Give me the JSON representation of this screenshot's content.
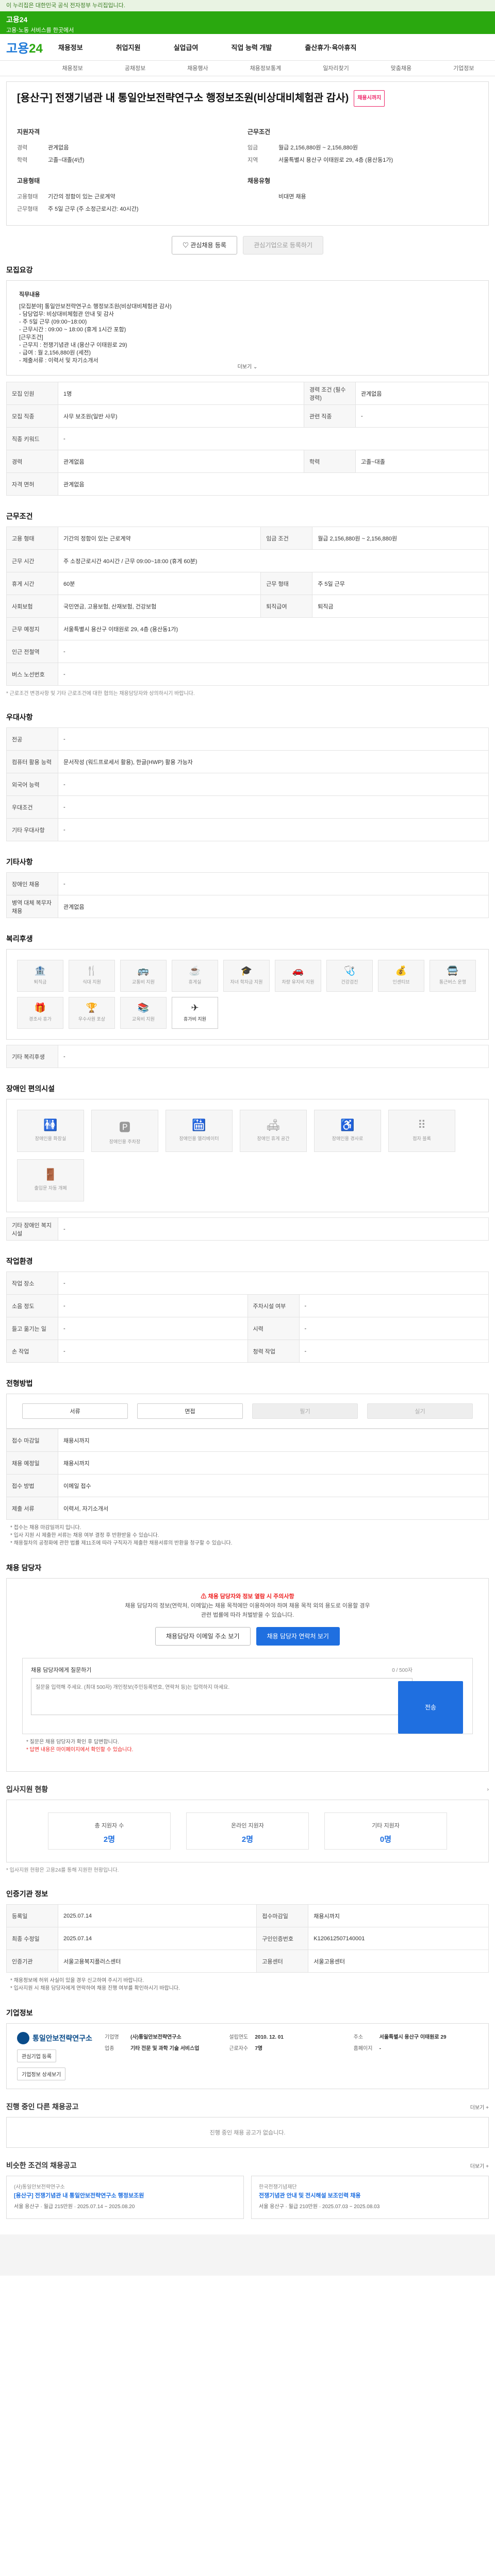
{
  "topbar": {
    "text": "이 누리집은 대한민국 공식 전자정부 누리집입니다."
  },
  "banner": {
    "title": "고용24",
    "subtitle": "고용·노동 서비스를 한곳에서"
  },
  "nav": {
    "logo_a": "고용",
    "logo_b": "24",
    "items": [
      "채용정보",
      "취업지원",
      "실업급여",
      "직업 능력 개발",
      "출산휴가·육아휴직"
    ]
  },
  "subnav": [
    "채용정보",
    "공채정보",
    "채용행사",
    "채용정보통계",
    "일자리찾기",
    "맞춤채용",
    "기업정보"
  ],
  "job": {
    "title": "[용산구] 전쟁기념관 내 통일안보전략연구소 행정보조원(비상대비체험관 감사)",
    "tag": "채용시까지",
    "summary_left_title": "지원자격",
    "left": [
      {
        "k": "경력",
        "v": "관계없음"
      },
      {
        "k": "학력",
        "v": "고졸~대졸(4년)"
      }
    ],
    "emp_title": "고용형태",
    "emp": [
      {
        "k": "고용형태",
        "v": "기간의 정함이 있는 근로계약"
      },
      {
        "k": "근무형태",
        "v": "주 5일 근무 (주 소정근로시간: 40시간)"
      }
    ],
    "summary_right_title": "근무조건",
    "right": [
      {
        "k": "임금",
        "v": "월급 2,156,880원 ~ 2,156,880원"
      },
      {
        "k": "지역",
        "v": "서울특별시 용산구 이태원로 29, 4층 (용산동1가)"
      }
    ],
    "reg_title": "채용유형",
    "reg": [
      {
        "k": "",
        "v": "비대면 채용"
      }
    ],
    "btn_interest": "관심채용 등록",
    "btn_interest_company": "관심기업으로 등록하기"
  },
  "sections": {
    "recruit": "모집요강",
    "conditions": "근무조건",
    "prefer": "우대사항",
    "other": "기타사항",
    "welfare": "복리후생",
    "disabled": "장애인 편의시설",
    "workplace": "작업환경",
    "process": "전형방법",
    "contact": "채용 담당자",
    "applicants": "입사지원 현황",
    "info": "인증기관 정보",
    "company": "기업정보",
    "other_jobs": "진행 중인 다른 채용공고",
    "similar": "비슷한 조건의 채용공고"
  },
  "desc": {
    "heading": "직무내용",
    "lines": [
      "[모집분야] 통일안보전략연구소 행정보조원(비상대비체험관 감사)",
      "- 담당업무: 비상대비체험관 안내 및 감사",
      "- 주 5일 근무 (09:00~18:00)",
      "- 근무시간 : 09:00 ~ 18:00 (휴게 1시간 포함)",
      "[근무조건]",
      "- 근무지 : 전쟁기념관 내 (용산구 이태원로 29)",
      "- 급여 : 월 2,156,880원 (세전)",
      "- 제출서류 : 이력서 및 자기소개서"
    ],
    "more": "더보기"
  },
  "recruit_table": [
    [
      "모집 인원",
      "1명",
      "경력 조건 (필수 경력)",
      "관계없음"
    ],
    [
      "모집 직종",
      "사무 보조원(일반 사무)",
      "관련 직종",
      "-"
    ],
    [
      "직종 키워드",
      "-",
      "",
      ""
    ],
    [
      "경력",
      "관계없음",
      "학력",
      "고졸~대졸"
    ],
    [
      "자격 면허",
      "관계없음",
      "",
      ""
    ]
  ],
  "cond_table": [
    [
      "고용 형태",
      "기간의 정함이 있는 근로계약",
      "임금 조건",
      "월급 2,156,880원 ~ 2,156,880원"
    ],
    [
      "근무 시간",
      "주 소정근로시간 40시간 / 근무 09:00~18:00 (휴게 60분)",
      "",
      ""
    ],
    [
      "휴게 시간",
      "60분",
      "근무 형태",
      "주 5일 근무"
    ],
    [
      "사회보험",
      "국민연금, 고용보험, 산재보험, 건강보험",
      "퇴직급여",
      "퇴직금"
    ],
    [
      "근무 예정지",
      "서울특별시 용산구 이태원로 29, 4층 (용산동1가)",
      "",
      ""
    ],
    [
      "인근 전철역",
      "-",
      "",
      ""
    ],
    [
      "버스 노선번호",
      "-",
      "",
      ""
    ]
  ],
  "cond_note": "* 근로조건 변경사항 및 기타 근로조건에 대한 협의는 채용담당자와 상의하시기 바랍니다.",
  "prefer_table": [
    [
      "전공",
      "-"
    ],
    [
      "컴퓨터 활용 능력",
      "문서작성 (워드프로세서 활용), 한글(HWP) 활용 가능자"
    ],
    [
      "외국어 능력",
      "-"
    ],
    [
      "우대조건",
      "-"
    ],
    [
      "기타 우대사항",
      "-"
    ]
  ],
  "other_table": [
    [
      "장애인 채용",
      "-"
    ],
    [
      "병역 대체 복무자 채용",
      "관계없음"
    ]
  ],
  "welfare": {
    "items": [
      "퇴직금",
      "식대 지원",
      "교통비 지원",
      "휴게실",
      "자녀 학자금 지원",
      "차량 유지비 지원",
      "건강검진",
      "인센티브",
      "통근버스 운행",
      "경조사 휴가",
      "우수사원 포상",
      "교육비 지원",
      "휴가비 지원"
    ],
    "active_index": 12,
    "other_label": "기타 복리후생",
    "other_value": "-"
  },
  "facilities": {
    "items": [
      "장애인용 화장실",
      "장애인용 주차장",
      "장애인용 엘리베이터",
      "장애인 휴게 공간",
      "장애인용 경사로",
      "점자 블록",
      "출입문 자동 개폐"
    ],
    "other_label": "기타 장애인 복지시설",
    "other_value": "-"
  },
  "workplace_table": [
    [
      "작업 장소",
      "-",
      "",
      ""
    ],
    [
      "소음 정도",
      "-",
      "주차시설 여부",
      "-"
    ],
    [
      "들고 옮기는 일",
      "-",
      "시력",
      "-"
    ],
    [
      "손 작업",
      "-",
      "청력 작업",
      "-"
    ]
  ],
  "process": {
    "steps": [
      "서류",
      "면접",
      "필기",
      "실기"
    ],
    "active": [
      true,
      true,
      false,
      false
    ],
    "rows": [
      [
        "접수 마감일",
        "채용시까지"
      ],
      [
        "채용 예정일",
        "채용시까지"
      ],
      [
        "접수 방법",
        "이메일 접수"
      ],
      [
        "제출 서류",
        "이력서, 자기소개서"
      ]
    ],
    "notes": [
      "* 접수는 채용 마감일까지 입니다.",
      "* 입사 지원 시 제출한 서류는 채용 여부 결정 후 반환받을 수 있습니다.",
      "* 채용절차의 공정화에 관한 법률 제11조에 따라 구직자가 제출한 채용서류의 반환을 청구할 수 있습니다."
    ]
  },
  "apply": {
    "warn": "채용 담당자와 정보 열람 시 주의사항",
    "lines": [
      "채용 담당자의 정보(연락처, 이메일)는 채용 목적에만 이용하여야 하며 채용 목적 외의 용도로 이용할 경우",
      "관련 법률에 따라 처벌받을 수 있습니다."
    ],
    "btn_email": "채용담당자 이메일 주소 보기",
    "btn_phone": "채용 담당자 연락처 보기",
    "q_title": "채용 담당자에게 질문하기",
    "q_count": "0 / 500자",
    "q_placeholder": "질문을 입력해 주세요. (최대 500자) 개인정보(주민등록번호, 연락처 등)는 입력하지 마세요.",
    "q_send": "전송",
    "q_notes": [
      "* 질문은 채용 담당자가 확인 후 답변합니다.",
      "* 답변 내용은 마이페이지에서 확인할 수 있습니다."
    ]
  },
  "applicants": {
    "items": [
      {
        "label": "총 지원자 수",
        "value": "2명"
      },
      {
        "label": "온라인 지원자",
        "value": "2명"
      },
      {
        "label": "기타 지원자",
        "value": "0명"
      }
    ],
    "note": "* 입사지원 현황은 고용24를 통해 지원한 현황입니다."
  },
  "info_table": [
    [
      "등록일",
      "2025.07.14",
      "접수마감일",
      "채용시까지"
    ],
    [
      "최종 수정일",
      "2025.07.14",
      "구인인증번호",
      "K120612507140001"
    ],
    [
      "인증기관",
      "서울고용복지플러스센터",
      "고용센터",
      "서울고용센터"
    ]
  ],
  "info_notes": [
    "* 채용정보에 허위 사실이 있을 경우 신고하여 주시기 바랍니다.",
    "* 입사지원 시 채용 담당자에게 연락하여 채용 진행 여부를 확인하시기 바랍니다."
  ],
  "company": {
    "name": "통일안보전략연구소",
    "btn1": "관심기업 등록",
    "btn2": "기업정보 상세보기",
    "c1": [
      {
        "k": "기업명",
        "v": "(사)통일안보전략연구소"
      },
      {
        "k": "업종",
        "v": "기타 전문 및 과학 기술 서비스업"
      }
    ],
    "c2": [
      {
        "k": "설립연도",
        "v": "2010. 12. 01"
      },
      {
        "k": "근로자수",
        "v": "7명"
      }
    ],
    "c3": [
      {
        "k": "주소",
        "v": "서울특별시 용산구 이태원로 29"
      },
      {
        "k": "홈페이지",
        "v": "-"
      }
    ]
  },
  "other_jobs": {
    "more": "더보기 +",
    "empty": "진행 중인 채용 공고가 없습니다."
  },
  "similar": {
    "more": "더보기 +",
    "items": [
      {
        "company": "(사)통일안보전략연구소",
        "title": "[용산구] 전쟁기념관 내 통일안보전략연구소 행정보조원",
        "meta": "서울 용산구 · 월급 215만원 · 2025.07.14 ~ 2025.08.20"
      },
      {
        "company": "한국전쟁기념재단",
        "title": "전쟁기념관 안내 및 전시해설 보조인력 채용",
        "meta": "서울 용산구 · 월급 210만원 · 2025.07.03 ~ 2025.08.03"
      }
    ]
  }
}
